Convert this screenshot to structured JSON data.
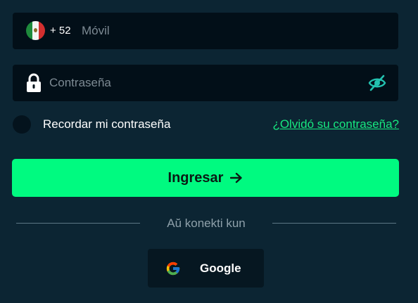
{
  "phone": {
    "country_prefix": "+ 52",
    "placeholder": "Móvil",
    "value": ""
  },
  "password": {
    "placeholder": "Contraseña",
    "value": ""
  },
  "remember": {
    "label": "Recordar mi contraseña"
  },
  "forgot_link": "¿Olvidó su contraseña?",
  "login_button": {
    "label": "Ingresar"
  },
  "divider_text": "Aŭ konekti kun",
  "google_button": {
    "label": "Google"
  },
  "colors": {
    "background": "#0c2533",
    "field": "#020f18",
    "accent": "#00fa80",
    "link": "#17e880"
  },
  "icons": [
    "mexico-flag-icon",
    "lock-icon",
    "eye-slash-icon",
    "arrow-right-icon",
    "google-icon"
  ]
}
